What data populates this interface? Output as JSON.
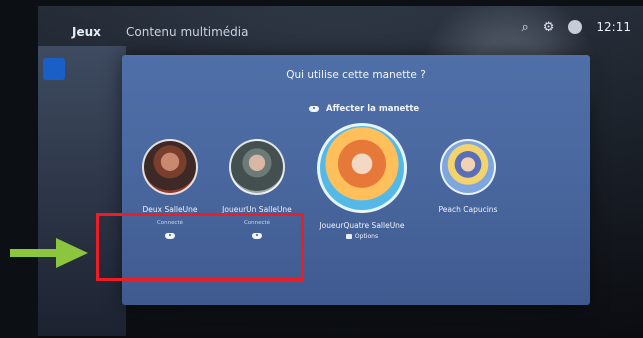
{
  "topbar": {
    "tab_games": "Jeux",
    "tab_media": "Contenu multimédia",
    "clock": "12:11",
    "icons": [
      "search-icon",
      "gear-icon",
      "user-icon"
    ]
  },
  "overlay": {
    "title": "Qui utilise cette manette ?",
    "assign_label": "Affecter la manette",
    "profiles": [
      {
        "name": "Deux SalleUne",
        "status": "Connecté",
        "controller": true
      },
      {
        "name": "JoueurUn SalleUne",
        "status": "Connecté",
        "controller": true
      },
      {
        "name": "JoueurQuatre SalleUne",
        "status": "",
        "options_label": "Options",
        "controller": false
      },
      {
        "name": "Peach Capucins",
        "status": "",
        "controller": false
      }
    ]
  },
  "colors": {
    "overlay_top": "#4f6fa8",
    "highlight_box": "#ee1c25",
    "arrow": "#8cc63f"
  }
}
